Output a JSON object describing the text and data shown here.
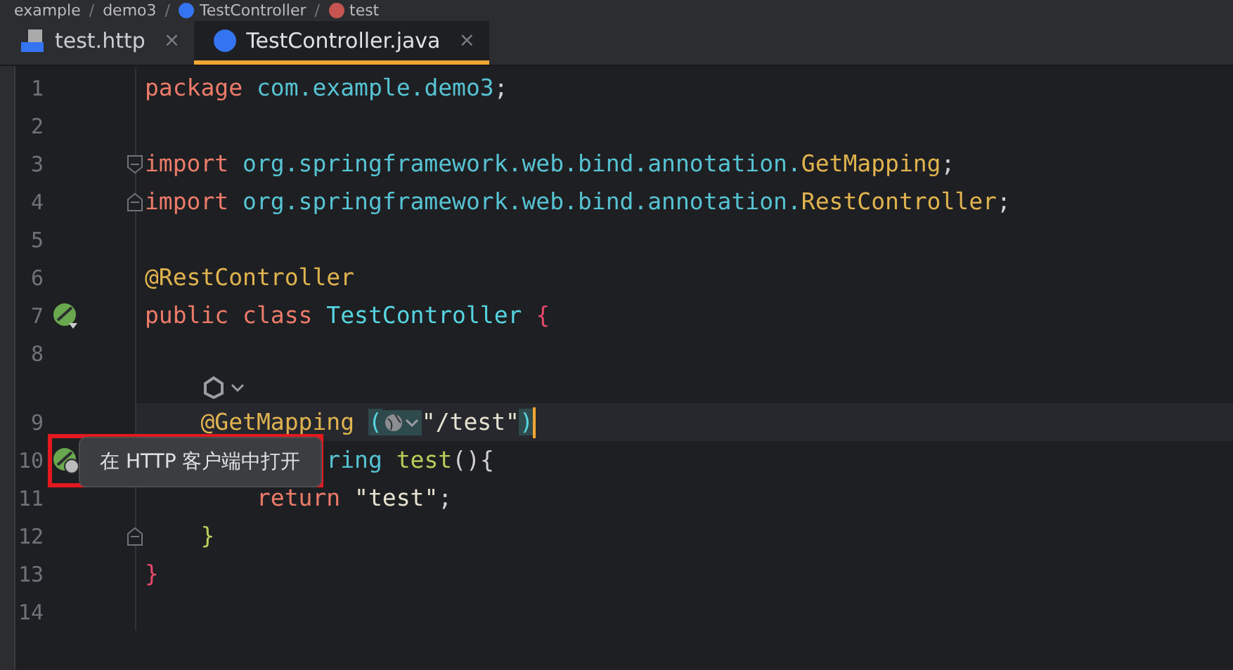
{
  "breadcrumb": {
    "separator": "/",
    "items": [
      {
        "text": "example",
        "kind": "package"
      },
      {
        "text": "demo3",
        "kind": "package"
      },
      {
        "text": "TestController",
        "kind": "class"
      },
      {
        "text": "test",
        "kind": "method"
      }
    ]
  },
  "tabs": [
    {
      "label": "test.http",
      "kind": "http",
      "close": "×",
      "selected": false
    },
    {
      "label": "TestController.java",
      "kind": "java",
      "close": "×",
      "selected": true
    }
  ],
  "lines": [
    {
      "kind": "plain",
      "number": "1",
      "current": false,
      "tokens": [
        {
          "text": "package",
          "kind": "keyword"
        },
        {
          "text": " com.example.demo3",
          "kind": "package"
        },
        {
          "text": ";",
          "kind": "punct"
        }
      ]
    },
    {
      "kind": "plain",
      "number": "2",
      "current": false
    },
    {
      "kind": "fold-start",
      "number": "3",
      "current": false,
      "tokens": [
        {
          "text": "import",
          "kind": "keyword"
        },
        {
          "text": " org.springframework.web.bind.annotation.",
          "kind": "package"
        },
        {
          "text": "GetMapping",
          "kind": "annotation"
        },
        {
          "text": ";",
          "kind": "punct"
        }
      ]
    },
    {
      "kind": "fold-end",
      "number": "4",
      "current": false,
      "tokens": [
        {
          "text": "import",
          "kind": "keyword"
        },
        {
          "text": " org.springframework.web.bind.annotation.",
          "kind": "package"
        },
        {
          "text": "RestController",
          "kind": "annotation"
        },
        {
          "text": ";",
          "kind": "punct"
        }
      ]
    },
    {
      "kind": "plain",
      "number": "5",
      "current": false
    },
    {
      "kind": "plain",
      "number": "6",
      "current": false,
      "tokens": [
        {
          "text": "@RestController",
          "kind": "annotation"
        }
      ]
    },
    {
      "kind": "bean",
      "number": "7",
      "current": false,
      "tokens": [
        {
          "text": "public class",
          "kind": "keyword"
        },
        {
          "text": " TestController",
          "kind": "class"
        },
        {
          "text": " {",
          "kind": "brace"
        }
      ]
    },
    {
      "kind": "plain",
      "number": "8",
      "current": false
    },
    {
      "kind": "inlay",
      "current": false
    },
    {
      "kind": "plain",
      "number": "9",
      "current": true,
      "tokens": [
        {
          "text": "    @GetMapping ",
          "kind": "annotation"
        },
        {
          "text": "(",
          "kind": "paren-match"
        },
        {
          "kind": "url-inlay"
        },
        {
          "text": "\"/test\"",
          "kind": "string"
        },
        {
          "text": ")",
          "kind": "paren-match"
        },
        {
          "kind": "caret"
        }
      ]
    },
    {
      "kind": "endpoint",
      "number": "10",
      "current": false,
      "tokens": [
        {
          "text": "             ring",
          "kind": "type"
        },
        {
          "text": " test",
          "kind": "method"
        },
        {
          "text": "(){",
          "kind": "punct"
        }
      ]
    },
    {
      "kind": "plain",
      "number": "11",
      "current": false,
      "tokens": [
        {
          "text": "        return",
          "kind": "keyword"
        },
        {
          "text": " \"test\"",
          "kind": "string"
        },
        {
          "text": ";",
          "kind": "punct"
        }
      ]
    },
    {
      "kind": "fold-end",
      "number": "12",
      "current": false,
      "tokens": [
        {
          "text": "    }",
          "kind": "method"
        }
      ]
    },
    {
      "kind": "plain",
      "number": "13",
      "current": false,
      "tokens": [
        {
          "text": "}",
          "kind": "brace"
        }
      ]
    },
    {
      "kind": "plain",
      "number": "14",
      "current": false
    }
  ],
  "tooltip": {
    "text": "在 HTTP 客户端中打开"
  }
}
